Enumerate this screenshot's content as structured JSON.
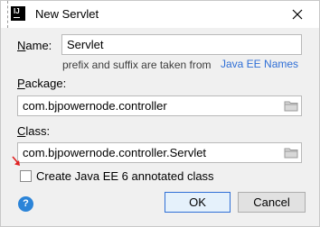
{
  "window": {
    "title": "New Servlet",
    "app_icon_text": "IJ"
  },
  "name_field": {
    "label_mnemonic": "N",
    "label_rest": "ame:",
    "value": "Servlet"
  },
  "hint": {
    "text": "prefix and suffix are taken from",
    "link": "Java EE Names"
  },
  "package_field": {
    "label_mnemonic": "P",
    "label_rest": "ackage:",
    "value": "com.bjpowernode.controller"
  },
  "class_field": {
    "label_mnemonic": "C",
    "label_rest": "lass:",
    "value": "com.bjpowernode.controller.Servlet"
  },
  "annotated_checkbox": {
    "label": "Create Java EE 6 annotated class",
    "checked": false
  },
  "buttons": {
    "help": "?",
    "ok": "OK",
    "cancel": "Cancel"
  },
  "colors": {
    "link": "#2f6fd6",
    "help_icon": "#2b84d8",
    "annotation_arrow": "#e02020"
  }
}
